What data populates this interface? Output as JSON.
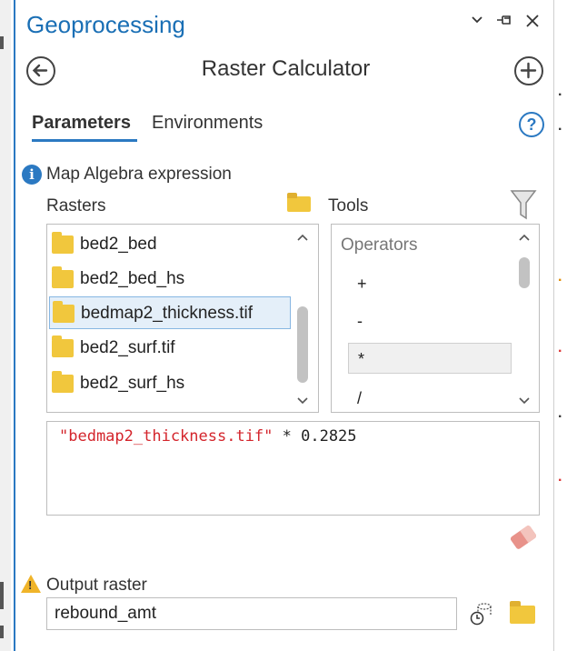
{
  "panel": {
    "title": "Geoprocessing",
    "tool_title": "Raster Calculator"
  },
  "tabs": [
    {
      "label": "Parameters",
      "active": true
    },
    {
      "label": "Environments",
      "active": false
    }
  ],
  "expression_section": {
    "label": "Map Algebra expression",
    "rasters_label": "Rasters",
    "tools_label": "Tools"
  },
  "rasters": [
    {
      "name": "bed2_bed",
      "selected": false
    },
    {
      "name": "bed2_bed_hs",
      "selected": false
    },
    {
      "name": "bedmap2_thickness.tif",
      "selected": true
    },
    {
      "name": "bed2_surf.tif",
      "selected": false
    },
    {
      "name": "bed2_surf_hs",
      "selected": false
    }
  ],
  "tools": {
    "category": "Operators",
    "items": [
      {
        "symbol": "+",
        "selected": false
      },
      {
        "symbol": "-",
        "selected": false
      },
      {
        "symbol": "*",
        "selected": true
      },
      {
        "symbol": "/",
        "selected": false
      }
    ]
  },
  "expression": {
    "string_part": "\"bedmap2_thickness.tif\"",
    "rest": " * 0.2825"
  },
  "output": {
    "label": "Output raster",
    "value": "rebound_amt"
  },
  "colors": {
    "accent": "#2b79c2",
    "title": "#1a6fb5",
    "string": "#d4252c",
    "folder": "#f1c73d",
    "warning": "#f0b429"
  }
}
